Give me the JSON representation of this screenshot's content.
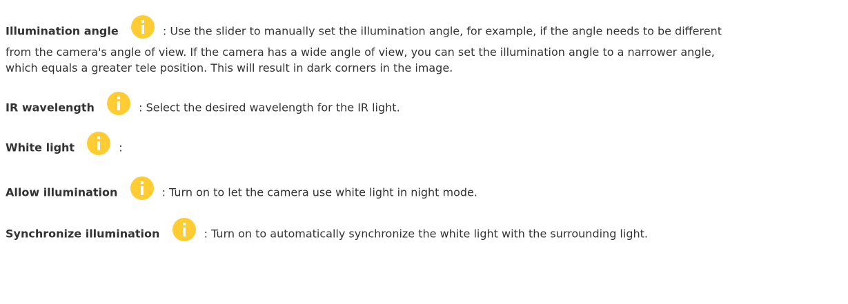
{
  "items": [
    {
      "term": "Illumination angle",
      "desc_line1": ": Use the slider to manually set the illumination angle, for example, if the angle needs to be different",
      "desc_line2": "from the camera's angle of view. If the camera has a wide angle of view, you can set the illumination angle to a narrower angle,",
      "desc_line3": "which equals a greater tele position. This will result in dark corners in the image."
    },
    {
      "term": "IR wavelength",
      "desc": ": Select the desired wavelength for the IR light."
    },
    {
      "term": "White light",
      "desc": ":"
    },
    {
      "term": "Allow illumination",
      "desc": ": Turn on to let the camera use white light in night mode."
    },
    {
      "term": "Synchronize illumination",
      "desc": ": Turn on to automatically synchronize the white light with the surrounding light."
    }
  ],
  "icons": {
    "info": "info-icon",
    "accent_color": "#FFCC33",
    "glyph_color": "#ffffff"
  }
}
